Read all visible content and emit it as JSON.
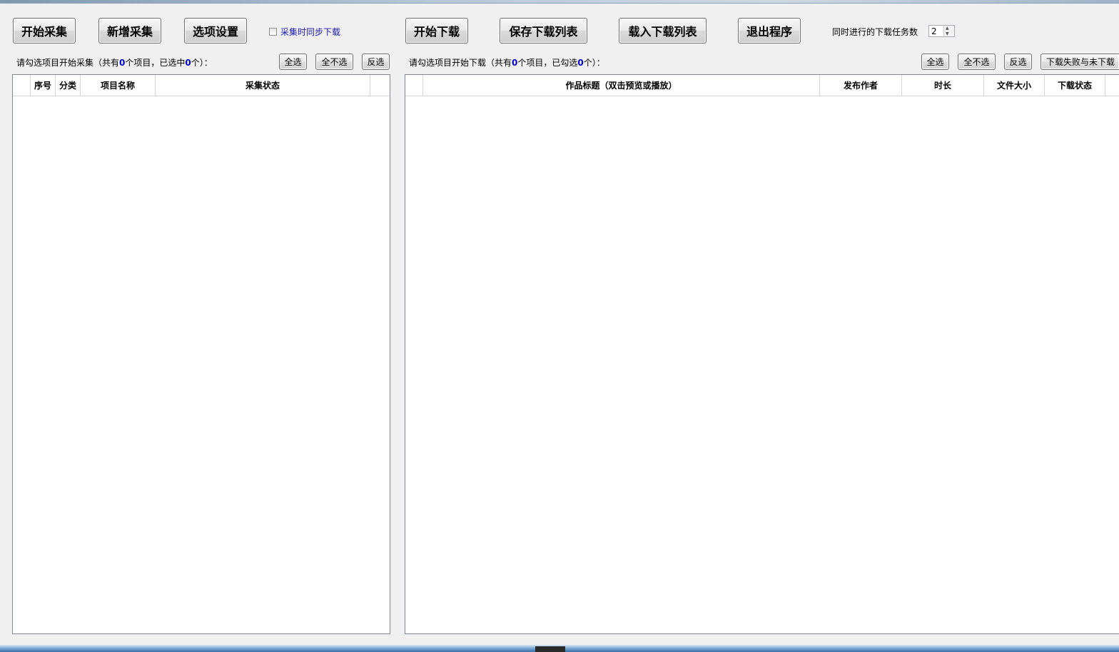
{
  "toolbar": {
    "start_collect": "开始采集",
    "add_collect": "新增采集",
    "options": "选项设置",
    "sync_download_label": "采集时同步下载",
    "sync_download_checked": false,
    "start_download": "开始下载",
    "save_list": "保存下载列表",
    "load_list": "载入下载列表",
    "exit": "退出程序",
    "concurrent_label": "同时进行的下载任务数",
    "concurrent_value": "2"
  },
  "collect_panel": {
    "prompt_prefix": "请勾选项目开始采集（共有",
    "total": "0",
    "prompt_mid": "个项目，已选中",
    "selected": "0",
    "prompt_suffix": "个）：",
    "select_all": "全选",
    "select_none": "全不选",
    "invert": "反选",
    "columns": [
      "",
      "序号",
      "分类",
      "项目名称",
      "采集状态",
      ""
    ],
    "rows": []
  },
  "download_panel": {
    "prompt_prefix": "请勾选项目开始下载（共有",
    "total": "0",
    "prompt_mid": "个项目，已勾选",
    "selected": "0",
    "prompt_suffix": "个）：",
    "select_all": "全选",
    "select_none": "全不选",
    "invert": "反选",
    "failed_button": "下载失败与未下载",
    "columns": [
      "",
      "作品标题（双击预览或播放）",
      "发布作者",
      "时长",
      "文件大小",
      "下载状态",
      ""
    ],
    "rows": []
  }
}
